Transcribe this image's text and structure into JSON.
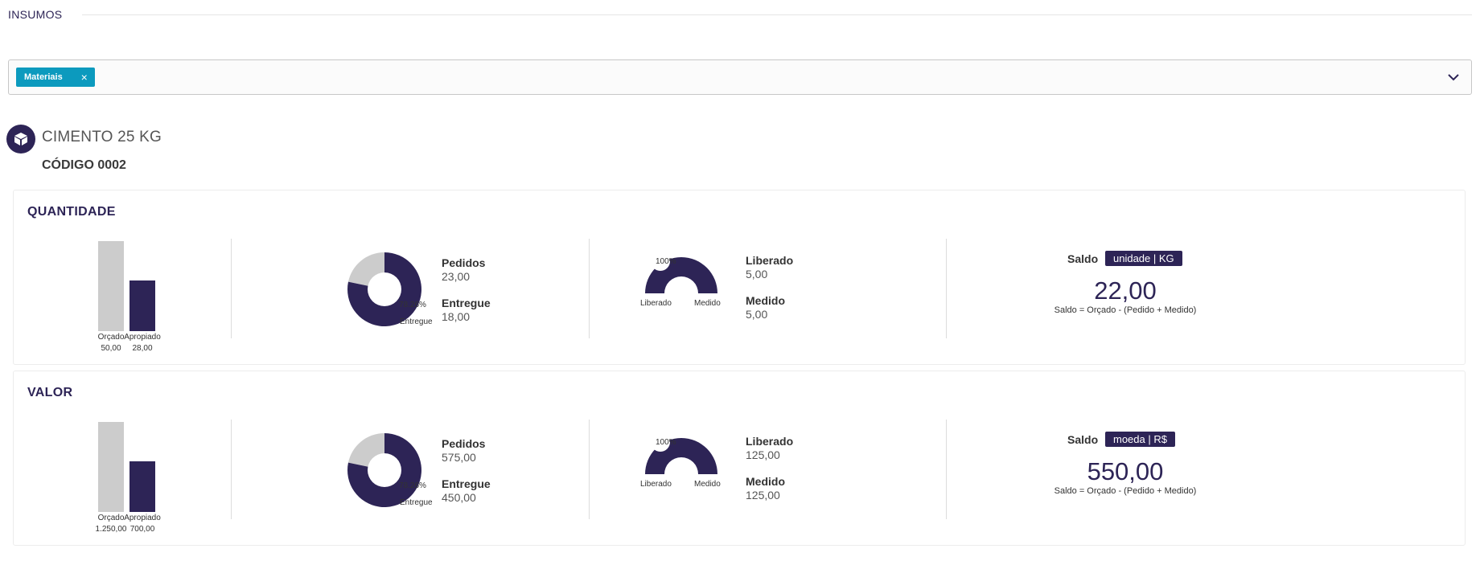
{
  "section": {
    "title": "INSUMOS"
  },
  "filter": {
    "chips": [
      {
        "label": "Materiais",
        "close": "×"
      }
    ],
    "icon": "chevron-down-icon",
    "accent_color": "#0c9abe"
  },
  "item": {
    "icon": "box-icon",
    "name": "CIMENTO 25 KG",
    "code": "CÓDIGO 0002"
  },
  "colors": {
    "primary": "#2d2456",
    "muted": "#cccccc"
  },
  "cards": [
    {
      "title": "QUANTIDADE",
      "bars": {
        "orcado": {
          "label": "Orçado",
          "value_label": "50,00"
        },
        "apropiado": {
          "label": "Apropiado",
          "value_label": "28,00"
        }
      },
      "donut": {
        "percent_label": "78.26%",
        "caption": "Entregue",
        "pedidos_label": "Pedidos",
        "pedidos_value": "23,00",
        "entregue_label": "Entregue",
        "entregue_value": "18,00"
      },
      "gauge": {
        "percent_label": "100%",
        "left_label": "Liberado",
        "right_label": "Medido",
        "liberado_label": "Liberado",
        "liberado_value": "5,00",
        "medido_label": "Medido",
        "medido_value": "5,00"
      },
      "saldo": {
        "label": "Saldo",
        "badge": "unidade | KG",
        "value": "22,00",
        "formula": "Saldo = Orçado - (Pedido + Medido)"
      }
    },
    {
      "title": "VALOR",
      "bars": {
        "orcado": {
          "label": "Orçado",
          "value_label": "1.250,00"
        },
        "apropiado": {
          "label": "Apropiado",
          "value_label": "700,00"
        }
      },
      "donut": {
        "percent_label": "78.26%",
        "caption": "Entregue",
        "pedidos_label": "Pedidos",
        "pedidos_value": "575,00",
        "entregue_label": "Entregue",
        "entregue_value": "450,00"
      },
      "gauge": {
        "percent_label": "100%",
        "left_label": "Liberado",
        "right_label": "Medido",
        "liberado_label": "Liberado",
        "liberado_value": "125,00",
        "medido_label": "Medido",
        "medido_value": "125,00"
      },
      "saldo": {
        "label": "Saldo",
        "badge": "moeda | R$",
        "value": "550,00",
        "formula": "Saldo = Orçado - (Pedido + Medido)"
      }
    }
  ],
  "chart_data": [
    {
      "type": "bar",
      "categories": [
        "Orçado",
        "Apropiado"
      ],
      "values": [
        50,
        28
      ],
      "ylim": [
        0,
        50
      ]
    },
    {
      "type": "pie",
      "labels": [
        "Entregue",
        "Pedidos"
      ],
      "values": [
        18,
        23
      ],
      "donut_percent": 78.26
    },
    {
      "type": "pie",
      "labels": [
        "Liberado",
        "Medido"
      ],
      "values": [
        5,
        5
      ],
      "gauge_percent": 100
    },
    {
      "type": "bar",
      "categories": [
        "Orçado",
        "Apropiado"
      ],
      "values": [
        1250,
        700
      ],
      "ylim": [
        0,
        1250
      ]
    },
    {
      "type": "pie",
      "labels": [
        "Entregue",
        "Pedidos"
      ],
      "values": [
        450,
        575
      ],
      "donut_percent": 78.26
    },
    {
      "type": "pie",
      "labels": [
        "Liberado",
        "Medido"
      ],
      "values": [
        125,
        125
      ],
      "gauge_percent": 100
    }
  ]
}
